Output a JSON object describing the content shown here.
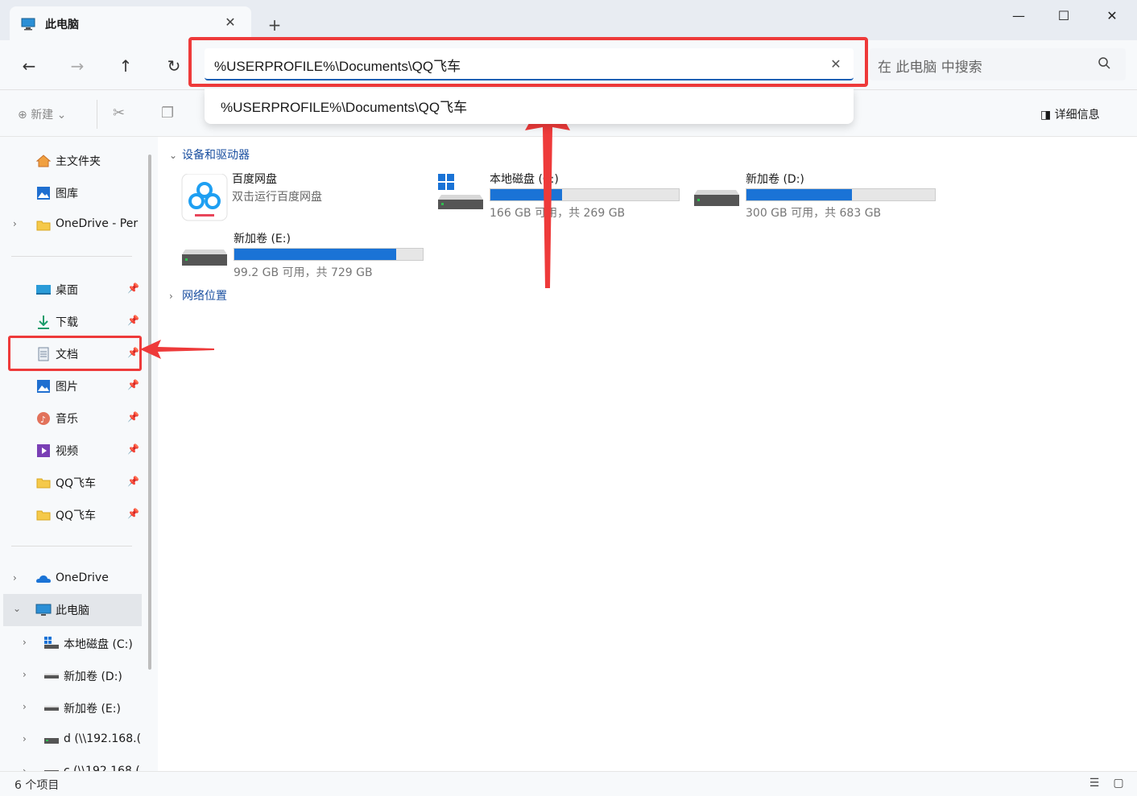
{
  "window": {
    "tab_title": "此电脑",
    "new_tab": "+",
    "minimize": "—",
    "maximize": "☐",
    "close": "✕"
  },
  "nav": {
    "back": "←",
    "forward": "→",
    "up": "↑",
    "refresh": "↻"
  },
  "address": {
    "value": "%USERPROFILE%\\Documents\\QQ飞车",
    "clear": "✕",
    "suggestion": "%USERPROFILE%\\Documents\\QQ飞车"
  },
  "search": {
    "placeholder": "在 此电脑 中搜索"
  },
  "toolbar": {
    "new_label": "新建",
    "details_label": "详细信息"
  },
  "sidebar": {
    "items": [
      {
        "label": "主文件夹",
        "icon": "home-icon"
      },
      {
        "label": "图库",
        "icon": "gallery-icon"
      },
      {
        "label": "OneDrive - Per",
        "icon": "folder-icon"
      },
      {
        "label": "桌面",
        "icon": "desktop-icon",
        "pinned": true
      },
      {
        "label": "下载",
        "icon": "download-icon",
        "pinned": true
      },
      {
        "label": "文档",
        "icon": "document-icon",
        "pinned": true
      },
      {
        "label": "图片",
        "icon": "pictures-icon",
        "pinned": true
      },
      {
        "label": "音乐",
        "icon": "music-icon",
        "pinned": true
      },
      {
        "label": "视频",
        "icon": "video-icon",
        "pinned": true
      },
      {
        "label": "QQ飞车",
        "icon": "folder-icon",
        "pinned": true
      },
      {
        "label": "QQ飞车",
        "icon": "folder-icon",
        "pinned": true
      },
      {
        "label": "OneDrive",
        "icon": "onedrive-icon"
      },
      {
        "label": "此电脑",
        "icon": "this-pc-icon"
      },
      {
        "label": "本地磁盘 (C:)",
        "icon": "windows-drive-icon"
      },
      {
        "label": "新加卷 (D:)",
        "icon": "drive-icon"
      },
      {
        "label": "新加卷 (E:)",
        "icon": "drive-icon"
      },
      {
        "label": "d (\\\\192.168.(",
        "icon": "network-drive-icon"
      },
      {
        "label": "c (\\\\192.168.(",
        "icon": "network-drive-icon"
      }
    ]
  },
  "main": {
    "devices_header": "设备和驱动器",
    "network_header": "网络位置",
    "devices": [
      {
        "name": "百度网盘",
        "subtitle": "双击运行百度网盘"
      },
      {
        "name": "本地磁盘 (C:)",
        "info": "166 GB 可用，共 269 GB",
        "used_fraction": 0.38
      },
      {
        "name": "新加卷 (D:)",
        "info": "300 GB 可用，共 683 GB",
        "used_fraction": 0.56
      },
      {
        "name": "新加卷 (E:)",
        "info": "99.2 GB 可用，共 729 GB",
        "used_fraction": 0.86
      }
    ]
  },
  "status": {
    "item_count": "6 个项目"
  },
  "colors": {
    "accent": "#1a73d6",
    "annotation": "#ee3a3a"
  }
}
